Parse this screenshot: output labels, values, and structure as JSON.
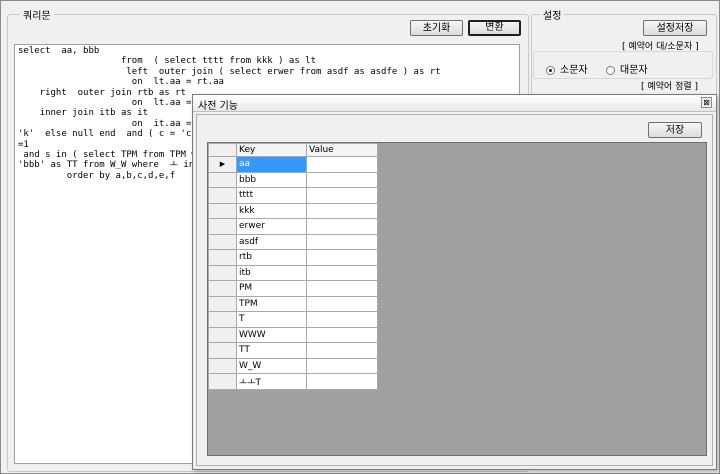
{
  "query": {
    "group_title": "쿼리문",
    "reset_label": "초기화",
    "convert_label": "변환",
    "text": "select  aa, bbb\n                   from  ( select tttt from kkk ) as lt\n                    left  outer join ( select erwer from asdf as asdfe ) as rt\n                     on  lt.aa = rt.aa\n    right  outer join rtb as rt\n                     on  lt.aa = rt.aa\n    inner join itb as it\n                     on  it.aa = lt.aa\n'k'  else null end  and ( c = 'c' or\n=1\n and s in ( select TPM from TPM where\n'bbb' as TT from W_W where  ㅗ in (\n         order by a,b,c,d,e,f"
  },
  "settings": {
    "group_title": "설정",
    "save_label": "설정저장",
    "case_note": "[ 예약어 대/소문자 ]",
    "radio_lower": "소문자",
    "radio_upper": "대문자",
    "align_note": "[ 예약어 정렬 ]"
  },
  "dialog": {
    "title": "사전 기능",
    "close_symbol": "⊠",
    "save_label": "저장",
    "columns": [
      "Key",
      "Value"
    ],
    "selected_indicator": "▶",
    "rows": [
      {
        "key": "aa",
        "value": ""
      },
      {
        "key": "bbb",
        "value": ""
      },
      {
        "key": "tttt",
        "value": ""
      },
      {
        "key": "kkk",
        "value": ""
      },
      {
        "key": "erwer",
        "value": ""
      },
      {
        "key": "asdf",
        "value": ""
      },
      {
        "key": "rtb",
        "value": ""
      },
      {
        "key": "itb",
        "value": ""
      },
      {
        "key": "PM",
        "value": ""
      },
      {
        "key": "TPM",
        "value": ""
      },
      {
        "key": "T",
        "value": ""
      },
      {
        "key": "WWW",
        "value": ""
      },
      {
        "key": "TT",
        "value": ""
      },
      {
        "key": "W_W",
        "value": ""
      },
      {
        "key": "ㅗㅗT",
        "value": ""
      }
    ]
  },
  "colors": {
    "selection": "#3399ff",
    "grid_background": "#a0a0a0"
  }
}
